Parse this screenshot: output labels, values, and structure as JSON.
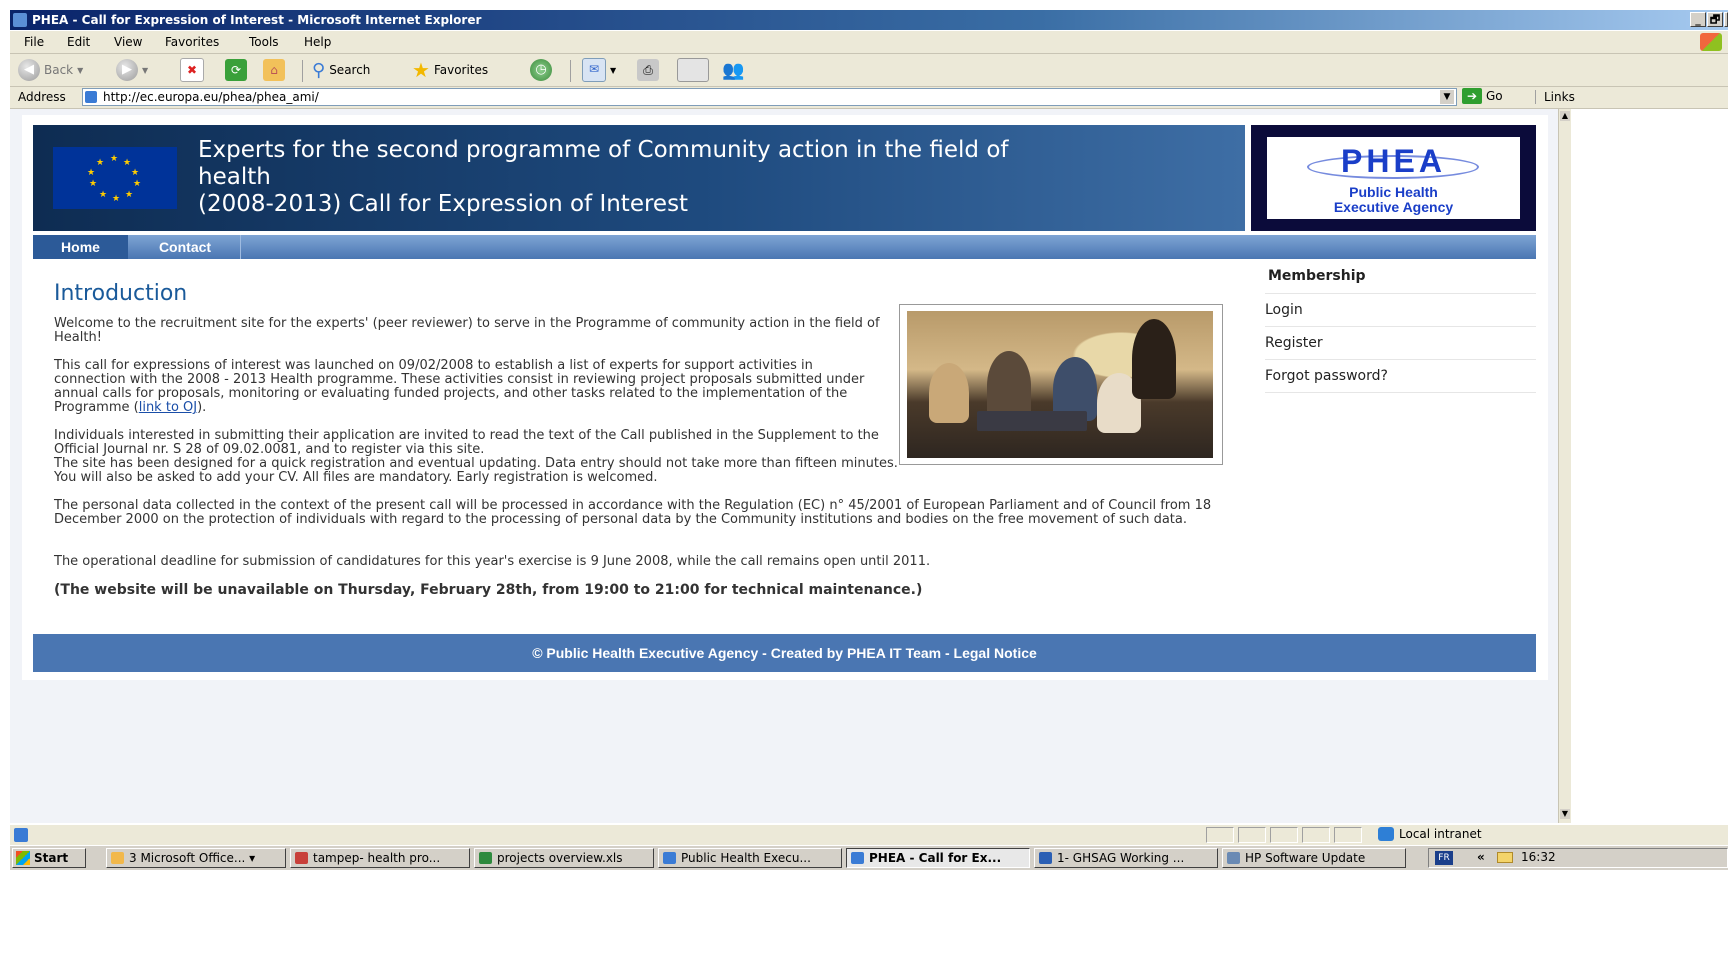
{
  "window": {
    "title": "PHEA - Call for Expression of Interest - Microsoft Internet Explorer",
    "buttons": [
      "_",
      "🗗",
      "✕"
    ]
  },
  "menu": [
    "File",
    "Edit",
    "View",
    "Favorites",
    "Tools",
    "Help"
  ],
  "toolbar": {
    "back_label": "Back",
    "search_label": "Search",
    "favorites_label": "Favorites"
  },
  "address": {
    "label": "Address",
    "url": "http://ec.europa.eu/phea/phea_ami/",
    "go_label": "Go",
    "links_label": "Links"
  },
  "site": {
    "title_line1": "Experts for the second programme of Community action in the field of",
    "title_line2": "health",
    "title_line3": "(2008-2013) Call for Expression of Interest",
    "logo_text": "PHEA",
    "logo_sub1": "Public Health",
    "logo_sub2": "Executive Agency",
    "nav": [
      "Home",
      "Contact"
    ]
  },
  "content": {
    "heading": "Introduction",
    "p1": "Welcome to the recruitment site for the experts' (peer reviewer) to serve in the Programme of community action in the field of Health!",
    "p2": "This call for expressions of interest was launched on 09/02/2008 to establish a list of experts for support activities in connection with the 2008 - 2013 Health programme. These activities consist in reviewing project proposals submitted under annual calls for proposals, monitoring or evaluating funded projects, and other tasks related to the implementation of the Programme (",
    "p2_link": "link to OJ",
    "p2_end": ").",
    "p3a": "Individuals interested in submitting their application are invited to read the text of the Call published in the Supplement to the Official Journal nr. S 28 of 09.02.0081, and to register via this site.",
    "p3b": "The site has been designed for a quick registration and eventual updating. Data entry should not take more than fifteen minutes. You will also be asked to add your CV. All files are mandatory. Early registration is welcomed.",
    "p4": "The personal data collected in the context of the present call will be processed in accordance with the Regulation (EC) n° 45/2001 of European Parliament and of Council from 18 December 2000 on the protection of individuals with regard to the processing of personal data by the Community institutions and bodies on the free movement of such data.",
    "p5": "The operational deadline for submission of candidatures for this year's exercise is 9 June 2008, while the call remains open until 2011.",
    "notice": "(The website will be unavailable on Thursday, February 28th, from 19:00 to 21:00 for technical maintenance.)"
  },
  "sidebar": {
    "heading": "Membership",
    "items": [
      "Login",
      "Register",
      "Forgot password?"
    ]
  },
  "footer": {
    "text": "© Public Health Executive Agency - Created by PHEA IT Team - Legal Notice"
  },
  "status": {
    "zone": "Local intranet"
  },
  "taskbar": {
    "start": "Start",
    "tasks": [
      "3 Microsoft Office... ▾",
      "tampep- health pro...",
      "projects overview.xls",
      "Public Health Execu...",
      "PHEA - Call for Ex...",
      "1- GHSAG Working ...",
      "HP Software Update"
    ],
    "lang": "FR",
    "clock": "16:32"
  },
  "colors": {
    "header_dark": "#0e2c52",
    "nav_blue": "#4a76b2",
    "heading_blue": "#1a5a9a",
    "logo_blue": "#1a3ec8"
  }
}
